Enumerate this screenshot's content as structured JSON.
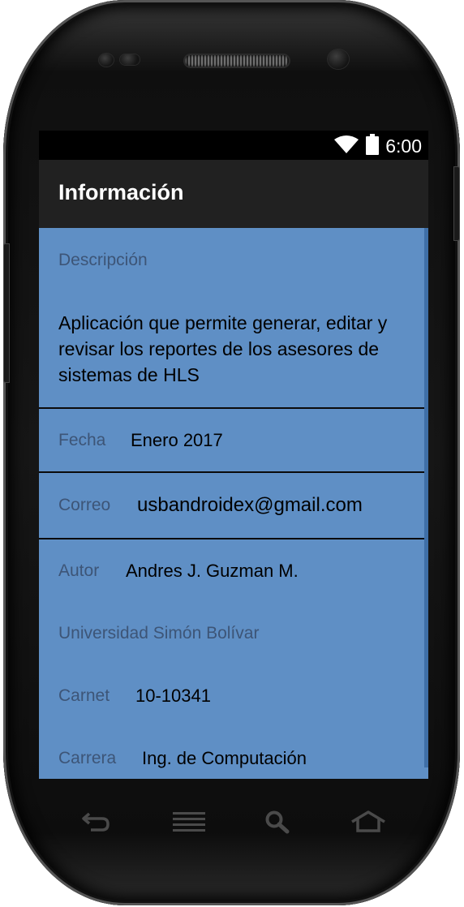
{
  "status_bar": {
    "time": "6:00",
    "icons": [
      "wifi-icon",
      "battery-icon"
    ]
  },
  "app_bar": {
    "title": "Información"
  },
  "descripcion": {
    "label": "Descripción",
    "text": "Aplicación que permite generar, editar y revisar los reportes de los asesores de sistemas de HLS"
  },
  "fecha": {
    "label": "Fecha",
    "value": "Enero 2017"
  },
  "correo": {
    "label": "Correo",
    "value": "usbandroidex@gmail.com"
  },
  "autor": {
    "label": "Autor",
    "value": "Andres J. Guzman M."
  },
  "universidad": {
    "label": "Universidad Simón Bolívar"
  },
  "carnet": {
    "label": "Carnet",
    "value": "10-10341"
  },
  "carrera": {
    "label": "Carrera",
    "value": "Ing. de Computación"
  },
  "nav_bar": {
    "buttons": [
      "back-icon",
      "menu-icon",
      "search-icon",
      "home-icon"
    ]
  },
  "colors": {
    "content_background": "#5f8fc5",
    "app_bar": "#212121",
    "label_text": "#3d5577"
  }
}
